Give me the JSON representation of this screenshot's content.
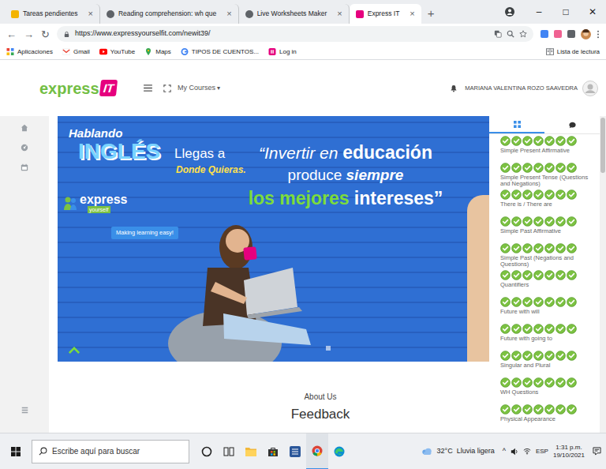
{
  "browser": {
    "tabs": [
      {
        "label": "Tareas pendientes",
        "selected": false
      },
      {
        "label": "Reading comprehension: wh que",
        "selected": false
      },
      {
        "label": "Live Worksheets Maker",
        "selected": false
      },
      {
        "label": "Express IT",
        "selected": true
      }
    ],
    "tab_close": "×",
    "new_tab": "+",
    "window_controls": [
      "–",
      "□",
      "✕"
    ],
    "nav": [
      "←",
      "→",
      "↻"
    ],
    "url": "https://www.expressyourselfit.com/newit39/",
    "bookmarks": [
      "Aplicaciones",
      "Gmail",
      "YouTube",
      "Maps",
      "TIPOS DE CUENTOS...",
      "Log in"
    ],
    "reading_list": "Lista de lectura"
  },
  "header": {
    "logo": "express",
    "logo_mark": "IT",
    "menu": "My Courses",
    "menu_caret": "▾",
    "user": "MARIANA VALENTINA ROZO SAAVEDRA"
  },
  "banner": {
    "hablando": "Hablando",
    "ingles": "INGLÉS",
    "llegas": "Llegas a",
    "donde": "Donde Quieras.",
    "brand": "express",
    "brand_sub": "yourself",
    "tagline": "Making learning easy!",
    "quote": [
      [
        "“Invertir en ",
        "educación"
      ],
      [
        "produce ",
        "siempre"
      ],
      [
        "los mejores ",
        "intereses”"
      ]
    ]
  },
  "badges": {
    "tabs": [
      {
        "selected": true
      },
      {
        "selected": false
      }
    ],
    "items": [
      {
        "label": "Simple Present Affirmative",
        "earned": 7
      },
      {
        "label": "Simple Present Tense (Questions and Negations)",
        "earned": 7
      },
      {
        "label": "There is / There are",
        "earned": 7
      },
      {
        "label": "Simple Past Affirmative",
        "earned": 7
      },
      {
        "label": "Simple Past (Negations and Questions)",
        "earned": 7
      },
      {
        "label": "Quantifiers",
        "earned": 7
      },
      {
        "label": "Future with will",
        "earned": 7
      },
      {
        "label": "Future with going to",
        "earned": 7
      },
      {
        "label": "Singular and Plural",
        "earned": 7
      },
      {
        "label": "WH Questions",
        "earned": 7
      },
      {
        "label": "Physical Appearance",
        "earned": 7
      }
    ]
  },
  "footer": [
    "About Us",
    "Feedback"
  ],
  "taskbar": {
    "search": "Escribe aquí para buscar",
    "weather": "32°C  Lluvia ligera",
    "tray": "^",
    "lang": "ESP",
    "time": "1:31 p.m.",
    "date": "19/10/2021"
  }
}
